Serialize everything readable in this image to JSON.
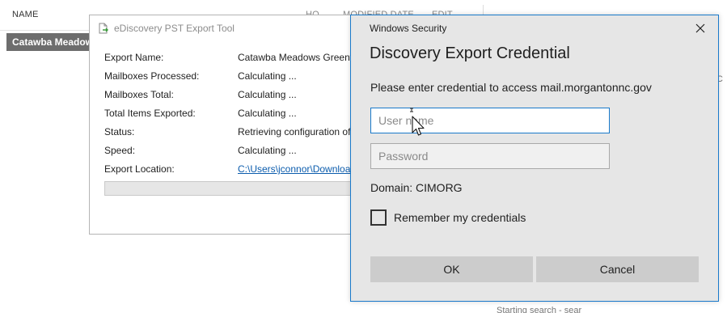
{
  "background": {
    "columns": [
      "NAME",
      "HO",
      "MODIFIED DATE",
      "EDIT"
    ],
    "selected_row": "Catawba Meadow",
    "right_text": "C",
    "bottom_text": "Starting search - sear"
  },
  "export_tool": {
    "title": "eDiscovery PST Export Tool",
    "rows": [
      {
        "label": "Export Name:",
        "value": "Catawba Meadows Greenw"
      },
      {
        "label": "Mailboxes Processed:",
        "value": "Calculating ..."
      },
      {
        "label": "Mailboxes Total:",
        "value": "Calculating ..."
      },
      {
        "label": "Total Items Exported:",
        "value": "Calculating ..."
      },
      {
        "label": "Status:",
        "value": "Retrieving configuration of"
      },
      {
        "label": "Speed:",
        "value": "Calculating ..."
      },
      {
        "label": "Export Location:",
        "value": "C:\\Users\\jconnor\\Downloa"
      }
    ],
    "progress": 0
  },
  "dialog": {
    "caption": "Windows Security",
    "heading": "Discovery Export Credential",
    "prompt": "Please enter credential to access mail.morgantonnc.gov",
    "username": {
      "value": "",
      "placeholder": "User name"
    },
    "password": {
      "value": "",
      "placeholder": "Password"
    },
    "domain": "Domain: CIMORG",
    "remember_label": "Remember my credentials",
    "remember_checked": false,
    "ok_label": "OK",
    "cancel_label": "Cancel",
    "accent": "#1979ca"
  }
}
